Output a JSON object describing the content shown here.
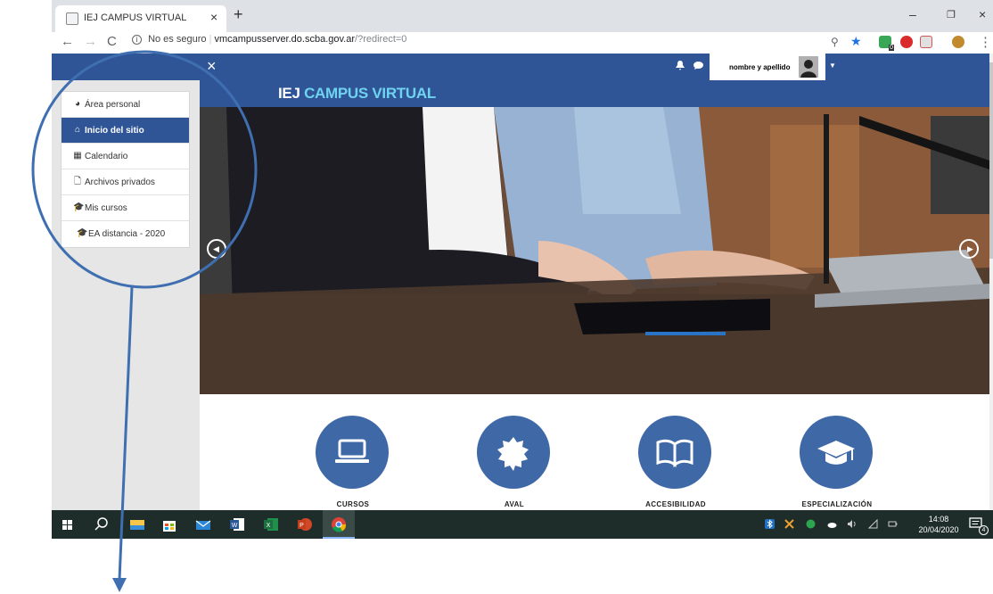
{
  "browser": {
    "tab_title": "IEJ CAMPUS VIRTUAL",
    "tab_close": "×",
    "new_tab": "+",
    "security_label": "No es seguro",
    "url_host": "vmcampusserver.do.scba.gov.ar",
    "url_path": "/?redirect=0",
    "extension_badge": "0",
    "window_controls": {
      "minimize": "–",
      "maximize": "❐",
      "close": "×"
    }
  },
  "site": {
    "brand_part1": "IEJ",
    "brand_part2": "CAMPUS VIRTUAL",
    "close_drawer": "×",
    "user_name": "nombre y apellido"
  },
  "sidebar": {
    "items": [
      {
        "label": "Área personal",
        "icon": "dashboard-icon",
        "glyph": "◕"
      },
      {
        "label": "Inicio del sitio",
        "icon": "home-icon",
        "glyph": "⌂",
        "active": true
      },
      {
        "label": "Calendario",
        "icon": "calendar-icon",
        "glyph": "▦"
      },
      {
        "label": "Archivos privados",
        "icon": "file-icon",
        "glyph": "🗋"
      },
      {
        "label": "Mis cursos",
        "icon": "graduation-cap-icon",
        "glyph": "🎓"
      },
      {
        "label": "EA distancia - 2020",
        "icon": "graduation-cap-icon",
        "glyph": "🎓"
      }
    ]
  },
  "categories": [
    {
      "label": "CURSOS",
      "icon": "laptop-icon"
    },
    {
      "label": "AVAL",
      "icon": "badge-icon"
    },
    {
      "label": "ACCESIBILIDAD",
      "icon": "book-icon"
    },
    {
      "label": "ESPECIALIZACIÓN",
      "icon": "graduation-cap-icon"
    }
  ],
  "taskbar": {
    "time": "14:08",
    "date": "20/04/2020",
    "notification_count": "4"
  },
  "colors": {
    "primary": "#2f5597",
    "circle": "#3f68a7",
    "brand_accent": "#6fd3f0",
    "annotation": "#3f6fb0",
    "taskbar": "#1e2d2a"
  }
}
